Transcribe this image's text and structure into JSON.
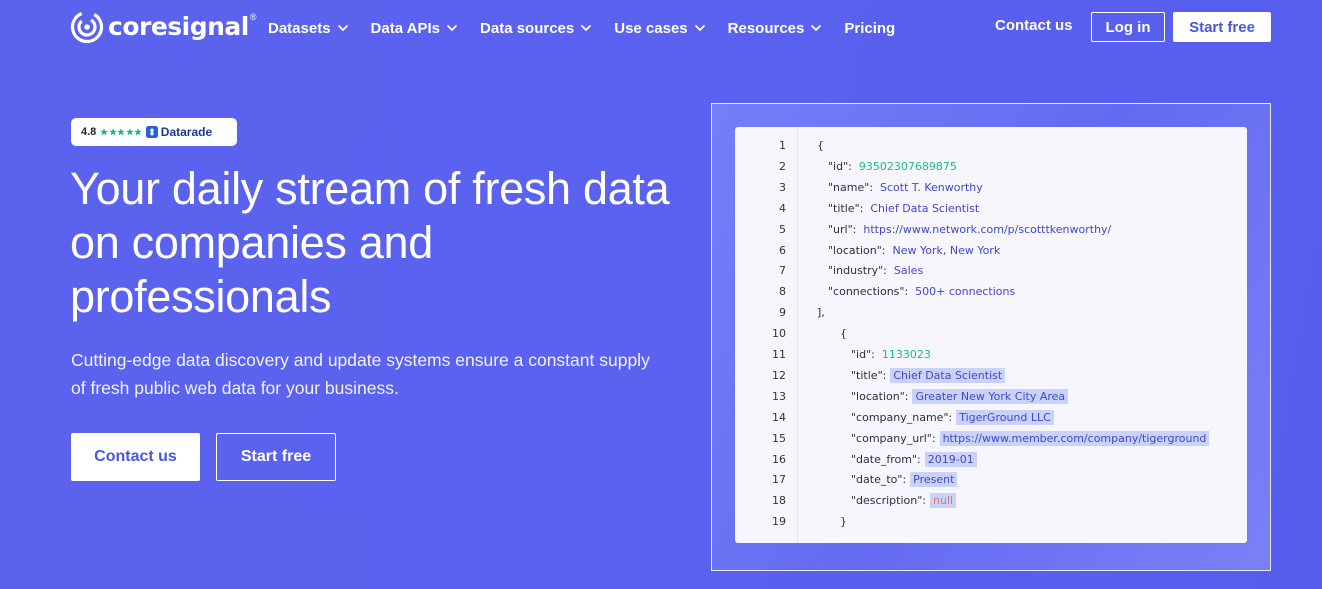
{
  "brand": {
    "name": "coresignal",
    "reg": "®"
  },
  "nav": {
    "items": [
      {
        "label": "Datasets",
        "has_dropdown": true
      },
      {
        "label": "Data APIs",
        "has_dropdown": true
      },
      {
        "label": "Data sources",
        "has_dropdown": true
      },
      {
        "label": "Use cases",
        "has_dropdown": true
      },
      {
        "label": "Resources",
        "has_dropdown": true
      },
      {
        "label": "Pricing",
        "has_dropdown": false
      }
    ],
    "contact": "Contact us",
    "login": "Log in",
    "start_free": "Start free"
  },
  "badge": {
    "rating": "4.8",
    "stars": 5,
    "brand": "Datarade"
  },
  "hero": {
    "title": "Your daily stream of fresh data on companies and professionals",
    "subtitle": "Cutting-edge data discovery and update systems ensure a constant supply of fresh public web data for your business.",
    "contact_button": "Contact us",
    "start_button": "Start free"
  },
  "colors": {
    "accent": "#5a62ef",
    "button_text": "#4c55dd",
    "json_number": "#1fba8a",
    "json_string": "#4148c8",
    "json_null": "#e07575",
    "highlight": "#c9d3fa"
  },
  "code": {
    "lines": [
      {
        "n": "1",
        "indent": 0,
        "text": "{"
      },
      {
        "n": "2",
        "indent": 1,
        "key": "\"id\":",
        "value": "93502307689875",
        "type": "num",
        "hl": false
      },
      {
        "n": "3",
        "indent": 1,
        "key": "\"name\":",
        "value": "Scott T. Kenworthy",
        "type": "str",
        "hl": false
      },
      {
        "n": "4",
        "indent": 1,
        "key": "\"title\":",
        "value": "Chief Data Scientist",
        "type": "str",
        "hl": false
      },
      {
        "n": "5",
        "indent": 1,
        "key": "\"url\":",
        "value": "https://www.network.com/p/scotttkenworthy/",
        "type": "str",
        "hl": false
      },
      {
        "n": "6",
        "indent": 1,
        "key": "\"location\":",
        "value": "New York, New York",
        "type": "str",
        "hl": false
      },
      {
        "n": "7",
        "indent": 1,
        "key": "\"industry\":",
        "value": "Sales",
        "type": "str",
        "hl": false
      },
      {
        "n": "8",
        "indent": 1,
        "key": "\"connections\":",
        "value": "500+ connections",
        "type": "str",
        "hl": false
      },
      {
        "n": "9",
        "indent": 0,
        "text": "],"
      },
      {
        "n": "10",
        "indent": 2,
        "text": "{"
      },
      {
        "n": "11",
        "indent": 3,
        "key": "\"id\":",
        "value": "1133023",
        "type": "num",
        "hl": false
      },
      {
        "n": "12",
        "indent": 3,
        "key": "\"title\":",
        "value": "Chief Data Scientist",
        "type": "str",
        "hl": true
      },
      {
        "n": "13",
        "indent": 3,
        "key": "\"location\":",
        "value": "Greater New York City Area",
        "type": "str",
        "hl": true
      },
      {
        "n": "14",
        "indent": 3,
        "key": "\"company_name\":",
        "value": "TigerGround LLC",
        "type": "str",
        "hl": true
      },
      {
        "n": "15",
        "indent": 3,
        "key": "\"company_url\":",
        "value": "https://www.member.com/company/tigerground",
        "type": "str",
        "hl": true
      },
      {
        "n": "16",
        "indent": 3,
        "key": "\"date_from\":",
        "value": "2019-01",
        "type": "str",
        "hl": true
      },
      {
        "n": "17",
        "indent": 3,
        "key": "\"date_to\":",
        "value": "Present",
        "type": "str",
        "hl": true
      },
      {
        "n": "18",
        "indent": 3,
        "key": "\"description\":",
        "value": "null",
        "type": "null",
        "hl": true
      },
      {
        "n": "19",
        "indent": 2,
        "text": "}"
      }
    ]
  }
}
